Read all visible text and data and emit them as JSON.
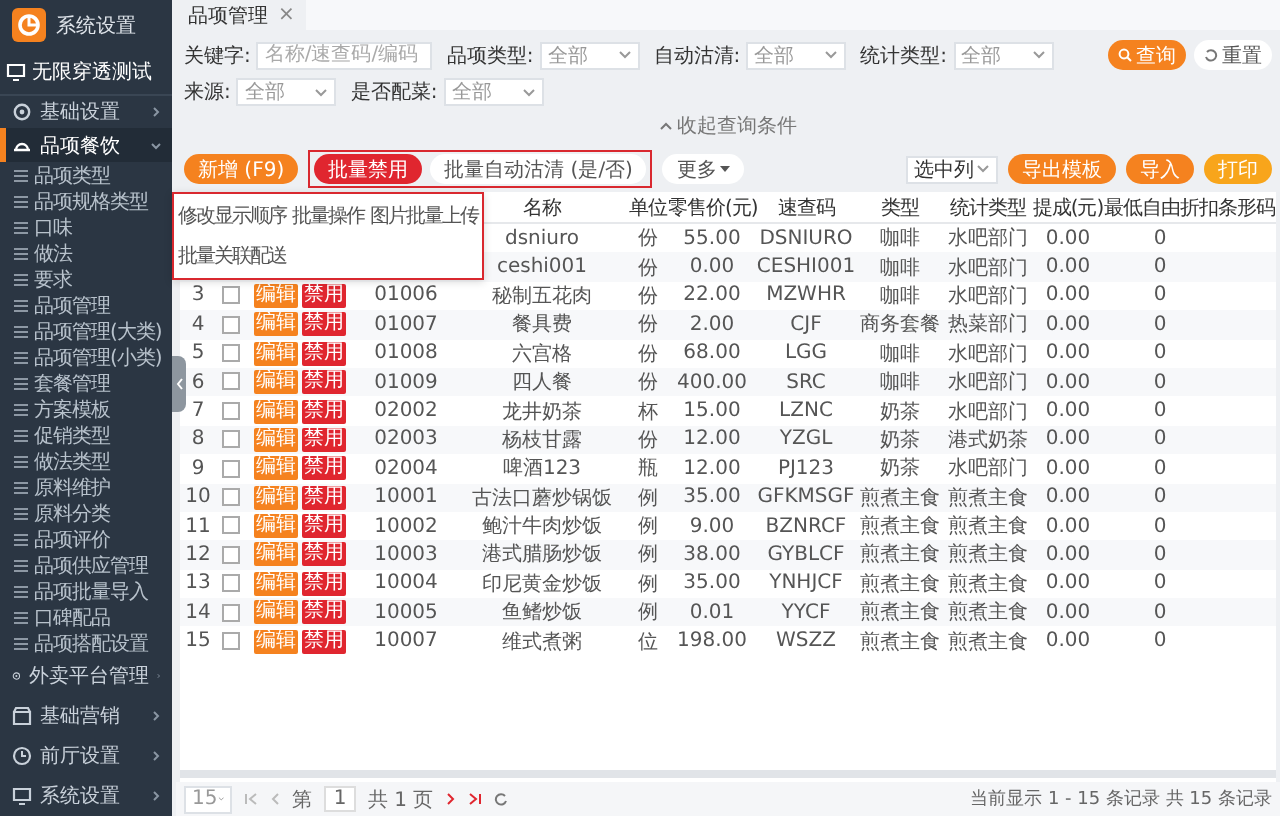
{
  "sidebar": {
    "app_title": "系统设置",
    "store": "无限穿透测试",
    "menu": [
      {
        "label": "基础设置",
        "kind": "gear",
        "expanded": false,
        "selected": false
      },
      {
        "label": "品项餐饮",
        "kind": "dish",
        "expanded": true,
        "selected": true,
        "children": [
          {
            "label": "品项类型"
          },
          {
            "label": "品项规格类型"
          },
          {
            "label": "口味"
          },
          {
            "label": "做法"
          },
          {
            "label": "要求"
          },
          {
            "label": "品项管理"
          },
          {
            "label": "品项管理(大类)"
          },
          {
            "label": "品项管理(小类)"
          },
          {
            "label": "套餐管理"
          },
          {
            "label": "方案模板"
          },
          {
            "label": "促销类型"
          },
          {
            "label": "做法类型"
          },
          {
            "label": "原料维护"
          },
          {
            "label": "原料分类"
          },
          {
            "label": "品项评价"
          },
          {
            "label": "品项供应管理"
          },
          {
            "label": "品项批量导入"
          },
          {
            "label": "口碑配品"
          },
          {
            "label": "品项搭配设置"
          }
        ]
      },
      {
        "label": "外卖平台管理",
        "kind": "gear",
        "expanded": false,
        "selected": false
      },
      {
        "label": "基础营销",
        "kind": "shop",
        "expanded": false,
        "selected": false
      },
      {
        "label": "前厅设置",
        "kind": "clock",
        "expanded": false,
        "selected": false
      },
      {
        "label": "系统设置",
        "kind": "monitor",
        "expanded": false,
        "selected": false
      }
    ]
  },
  "tabs": [
    {
      "label": "品项管理",
      "close": "×",
      "selected": true
    }
  ],
  "filters": [
    [
      {
        "label": "关键字:",
        "placeholder": "名称/速查码/编码"
      },
      {
        "label": "品项类型:",
        "value": "全部"
      },
      {
        "label": "自动沽清:",
        "value": "全部"
      },
      {
        "label": "统计类型:",
        "value": "全部"
      }
    ],
    [
      {
        "label": "来源:",
        "value": "全部"
      },
      {
        "label": "是否配菜:",
        "value": "全部"
      }
    ]
  ],
  "search_button": "查询",
  "reset_button": "重置",
  "collapse_link": "收起查询条件",
  "toolbar": {
    "add_button": "新增 (F9)",
    "batch_disable": "批量禁用",
    "batch_soldout": "批量自动沽清 (是/否)",
    "more_button": "更多",
    "column_select": "选中列",
    "right_buttons": [
      {
        "label": "导出模板",
        "kind": "orange"
      },
      {
        "label": "导入",
        "kind": "orange"
      },
      {
        "label": "打印",
        "kind": "amber"
      }
    ]
  },
  "more_menu": [
    [
      "修改显示顺序",
      "批量操作",
      "图片批量上传"
    ],
    [
      "批量关联配送"
    ]
  ],
  "table": {
    "columns": [
      "名称",
      "单位",
      "零售价(元)",
      "速查码",
      "类型",
      "统计类型",
      "提成(元)",
      "最低自由折扣",
      "条形码"
    ],
    "rows": [
      {
        "name": "dsniuro",
        "unit": "份",
        "price": "55.00",
        "quick": "DSNIURO",
        "type": "咖啡",
        "stat": "水吧部门",
        "commission": "0.00",
        "discount": "0"
      },
      {
        "name": "ceshi001",
        "unit": "份",
        "price": "0.00",
        "quick": "CESHI001",
        "type": "咖啡",
        "stat": "水吧部门",
        "commission": "0.00",
        "discount": "0"
      },
      {
        "no": "3",
        "edit": "编辑",
        "disable": "禁用",
        "code": "01006",
        "name": "秘制五花肉",
        "unit": "份",
        "price": "22.00",
        "quick": "MZWHR",
        "type": "咖啡",
        "stat": "水吧部门",
        "commission": "0.00",
        "discount": "0",
        "checked": false
      },
      {
        "no": "4",
        "edit": "编辑",
        "disable": "禁用",
        "code": "01007",
        "name": "餐具费",
        "unit": "份",
        "price": "2.00",
        "quick": "CJF",
        "type": "商务套餐",
        "stat": "热菜部门",
        "commission": "0.00",
        "discount": "0",
        "checked": false
      },
      {
        "no": "5",
        "edit": "编辑",
        "disable": "禁用",
        "code": "01008",
        "name": "六宫格",
        "unit": "份",
        "price": "68.00",
        "quick": "LGG",
        "type": "咖啡",
        "stat": "水吧部门",
        "commission": "0.00",
        "discount": "0",
        "checked": false
      },
      {
        "no": "6",
        "edit": "编辑",
        "disable": "禁用",
        "code": "01009",
        "name": "四人餐",
        "unit": "份",
        "price": "400.00",
        "quick": "SRC",
        "type": "咖啡",
        "stat": "水吧部门",
        "commission": "0.00",
        "discount": "0",
        "checked": false
      },
      {
        "no": "7",
        "edit": "编辑",
        "disable": "禁用",
        "code": "02002",
        "name": "龙井奶茶",
        "unit": "杯",
        "price": "15.00",
        "quick": "LZNC",
        "type": "奶茶",
        "stat": "水吧部门",
        "commission": "0.00",
        "discount": "0",
        "checked": false
      },
      {
        "no": "8",
        "edit": "编辑",
        "disable": "禁用",
        "code": "02003",
        "name": "杨枝甘露",
        "unit": "份",
        "price": "12.00",
        "quick": "YZGL",
        "type": "奶茶",
        "stat": "港式奶茶",
        "commission": "0.00",
        "discount": "0",
        "checked": false
      },
      {
        "no": "9",
        "edit": "编辑",
        "disable": "禁用",
        "code": "02004",
        "name": "啤酒123",
        "unit": "瓶",
        "price": "12.00",
        "quick": "PJ123",
        "type": "奶茶",
        "stat": "水吧部门",
        "commission": "0.00",
        "discount": "0",
        "checked": false
      },
      {
        "no": "10",
        "edit": "编辑",
        "disable": "禁用",
        "code": "10001",
        "name": "古法口蘑炒锅饭",
        "unit": "例",
        "price": "35.00",
        "quick": "GFKMSGF",
        "type": "煎煮主食",
        "stat": "煎煮主食",
        "commission": "0.00",
        "discount": "0",
        "checked": false
      },
      {
        "no": "11",
        "edit": "编辑",
        "disable": "禁用",
        "code": "10002",
        "name": "鲍汁牛肉炒饭",
        "unit": "例",
        "price": "9.00",
        "quick": "BZNRCF",
        "type": "煎煮主食",
        "stat": "煎煮主食",
        "commission": "0.00",
        "discount": "0",
        "checked": false
      },
      {
        "no": "12",
        "edit": "编辑",
        "disable": "禁用",
        "code": "10003",
        "name": "港式腊肠炒饭",
        "unit": "例",
        "price": "38.00",
        "quick": "GYBLCF",
        "type": "煎煮主食",
        "stat": "煎煮主食",
        "commission": "0.00",
        "discount": "0",
        "checked": false
      },
      {
        "no": "13",
        "edit": "编辑",
        "disable": "禁用",
        "code": "10004",
        "name": "印尼黄金炒饭",
        "unit": "例",
        "price": "35.00",
        "quick": "YNHJCF",
        "type": "煎煮主食",
        "stat": "煎煮主食",
        "commission": "0.00",
        "discount": "0",
        "checked": false
      },
      {
        "no": "14",
        "edit": "编辑",
        "disable": "禁用",
        "code": "10005",
        "name": "鱼鳍炒饭",
        "unit": "例",
        "price": "0.01",
        "quick": "YYCF",
        "type": "煎煮主食",
        "stat": "煎煮主食",
        "commission": "0.00",
        "discount": "0",
        "checked": false
      },
      {
        "no": "15",
        "edit": "编辑",
        "disable": "禁用",
        "code": "10007",
        "name": "维式煮粥",
        "unit": "位",
        "price": "198.00",
        "quick": "WSZZ",
        "type": "煎煮主食",
        "stat": "煎煮主食",
        "commission": "0.00",
        "discount": "0",
        "checked": false
      }
    ]
  },
  "pagination": {
    "page_size": "15",
    "page_prefix": "第",
    "page": "1",
    "total_pages": "共 1 页",
    "summary": "当前显示 1 - 15 条记录 共 15 条记录"
  }
}
